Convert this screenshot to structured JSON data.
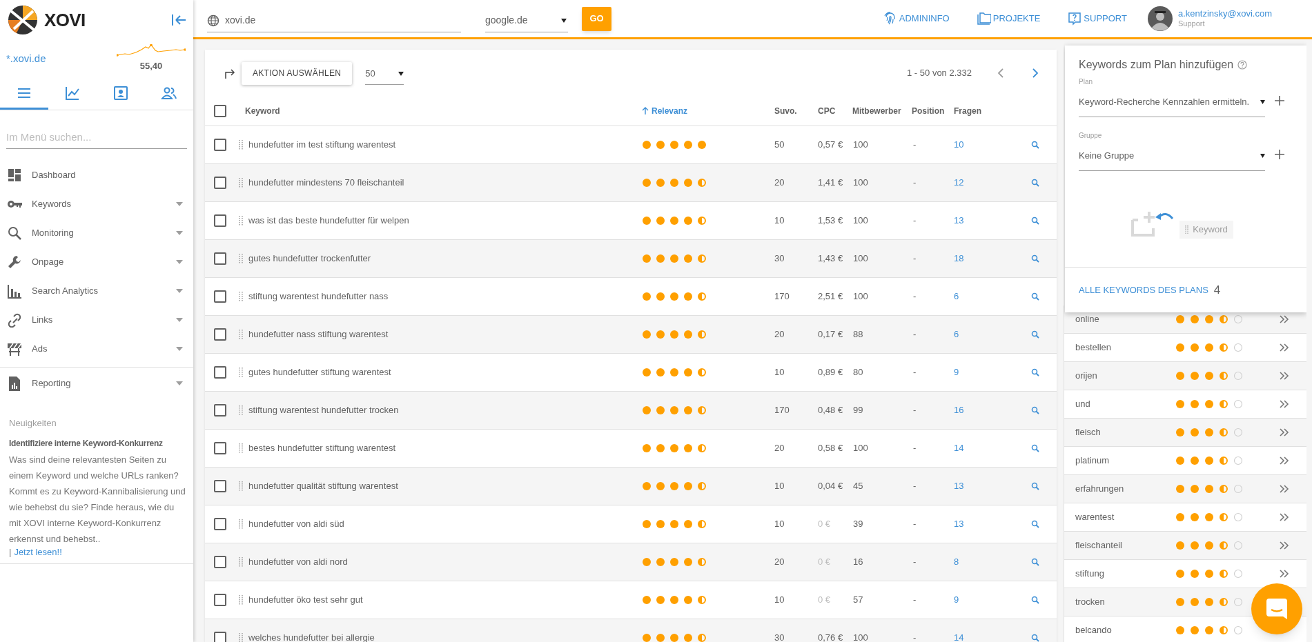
{
  "sidebar": {
    "brand": "XOVI",
    "domain": "*.xovi.de",
    "score": "55,40",
    "tabs": [
      {
        "selected": true
      },
      {
        "selected": false
      },
      {
        "selected": false
      },
      {
        "selected": false
      }
    ],
    "search": {
      "placeholder": "Im Menü suchen..."
    },
    "menu_sections": [
      {
        "items": [
          {
            "label": "Dashboard",
            "expandable": false
          },
          {
            "label": "Keywords",
            "expandable": true
          },
          {
            "label": "Monitoring",
            "expandable": true
          },
          {
            "label": "Onpage",
            "expandable": true
          },
          {
            "label": "Search Analytics",
            "expandable": true
          },
          {
            "label": "Links",
            "expandable": true
          },
          {
            "label": "Ads",
            "expandable": true
          }
        ]
      },
      {
        "items": [
          {
            "label": "Reporting",
            "expandable": true
          }
        ]
      }
    ],
    "news": {
      "heading": "Neuigkeiten",
      "title": "Identifiziere interne Keyword-Konkurrenz",
      "text": "Was sind deine relevantesten Seiten zu einem Keyword und welche URLs ranken? Kommt es zu Keyword-Kannibalisierung und wie behebst du sie? Finde heraus, wie du mit XOVI interne Keyword-Konkurrenz erkennst und behebst..",
      "separator": "|",
      "link": "Jetzt lesen!!"
    }
  },
  "topbar": {
    "domain": "xovi.de",
    "engine": "google.de",
    "go": "GO",
    "links": [
      "ADMININFO",
      "PROJEKTE",
      "SUPPORT"
    ],
    "user": {
      "email": "a.kentzinsky@xovi.com",
      "role": "Support"
    }
  },
  "toolbar": {
    "action": "AKTION AUSWÄHLEN",
    "page_size": "50",
    "range": "1 - 50 von 2.332"
  },
  "table": {
    "select_all_checked": false,
    "columns": [
      "Keyword",
      "Relevanz",
      "Suvo.",
      "CPC",
      "Mitbewerber",
      "Position",
      "Fragen"
    ],
    "rows": [
      {
        "keyword": "hundefutter im test stiftung warentest",
        "checked": false,
        "stars": 5,
        "suvo": "50",
        "cpc": "0,57 €",
        "cpc_muted": false,
        "competitors": "100",
        "position": "-",
        "questions": "10"
      },
      {
        "keyword": "hundefutter mindestens 70 fleischanteil",
        "checked": false,
        "stars": 4.5,
        "suvo": "20",
        "cpc": "1,41 €",
        "cpc_muted": false,
        "competitors": "100",
        "position": "-",
        "questions": "12"
      },
      {
        "keyword": "was ist das beste hundefutter für welpen",
        "checked": false,
        "stars": 4.5,
        "suvo": "10",
        "cpc": "1,53 €",
        "cpc_muted": false,
        "competitors": "100",
        "position": "-",
        "questions": "13"
      },
      {
        "keyword": "gutes hundefutter trockenfutter",
        "checked": false,
        "stars": 4.5,
        "suvo": "30",
        "cpc": "1,43 €",
        "cpc_muted": false,
        "competitors": "100",
        "position": "-",
        "questions": "18"
      },
      {
        "keyword": "stiftung warentest hundefutter nass",
        "checked": false,
        "stars": 4.5,
        "suvo": "170",
        "cpc": "2,51 €",
        "cpc_muted": false,
        "competitors": "100",
        "position": "-",
        "questions": "6"
      },
      {
        "keyword": "hundefutter nass stiftung warentest",
        "checked": false,
        "stars": 4.5,
        "suvo": "20",
        "cpc": "0,17 €",
        "cpc_muted": false,
        "competitors": "88",
        "position": "-",
        "questions": "6"
      },
      {
        "keyword": "gutes hundefutter stiftung warentest",
        "checked": false,
        "stars": 4.5,
        "suvo": "10",
        "cpc": "0,89 €",
        "cpc_muted": false,
        "competitors": "80",
        "position": "-",
        "questions": "9"
      },
      {
        "keyword": "stiftung warentest hundefutter trocken",
        "checked": false,
        "stars": 4.5,
        "suvo": "170",
        "cpc": "0,48 €",
        "cpc_muted": false,
        "competitors": "99",
        "position": "-",
        "questions": "16"
      },
      {
        "keyword": "bestes hundefutter stiftung warentest",
        "checked": false,
        "stars": 4.5,
        "suvo": "20",
        "cpc": "0,58 €",
        "cpc_muted": false,
        "competitors": "100",
        "position": "-",
        "questions": "14"
      },
      {
        "keyword": "hundefutter qualität stiftung warentest",
        "checked": false,
        "stars": 4.5,
        "suvo": "10",
        "cpc": "0,04 €",
        "cpc_muted": false,
        "competitors": "45",
        "position": "-",
        "questions": "13"
      },
      {
        "keyword": "hundefutter von aldi süd",
        "checked": false,
        "stars": 4.5,
        "suvo": "10",
        "cpc": "0 €",
        "cpc_muted": true,
        "competitors": "39",
        "position": "-",
        "questions": "13"
      },
      {
        "keyword": "hundefutter von aldi nord",
        "checked": false,
        "stars": 4.5,
        "suvo": "20",
        "cpc": "0 €",
        "cpc_muted": true,
        "competitors": "16",
        "position": "-",
        "questions": "8"
      },
      {
        "keyword": "hundefutter öko test sehr gut",
        "checked": false,
        "stars": 4.5,
        "suvo": "10",
        "cpc": "0 €",
        "cpc_muted": true,
        "competitors": "57",
        "position": "-",
        "questions": "9"
      },
      {
        "keyword": "welches hundefutter bei allergie",
        "checked": false,
        "stars": 4.5,
        "suvo": "30",
        "cpc": "0,76 €",
        "cpc_muted": false,
        "competitors": "100",
        "position": "-",
        "questions": "14"
      }
    ]
  },
  "plan_card": {
    "title": "Keywords zum Plan hinzufügen",
    "plan_label": "Plan",
    "plan_value": "Keyword-Recherche Kennzahlen ermitteln.",
    "group_label": "Gruppe",
    "group_value": "Keine Gruppe",
    "drop_hint": "Keyword",
    "all_link": "ALLE KEYWORDS DES PLANS",
    "count": "4"
  },
  "word_list": [
    {
      "word": "online",
      "stars": 3.5,
      "arrows": true
    },
    {
      "word": "bestellen",
      "stars": 3.5,
      "arrows": true
    },
    {
      "word": "orijen",
      "stars": 3.5,
      "arrows": true
    },
    {
      "word": "und",
      "stars": 3.5,
      "arrows": true
    },
    {
      "word": "fleisch",
      "stars": 3.5,
      "arrows": true
    },
    {
      "word": "platinum",
      "stars": 3.5,
      "arrows": true
    },
    {
      "word": "erfahrungen",
      "stars": 3.5,
      "arrows": true
    },
    {
      "word": "warentest",
      "stars": 3.5,
      "arrows": true
    },
    {
      "word": "fleischanteil",
      "stars": 3.5,
      "arrows": true
    },
    {
      "word": "stiftung",
      "stars": 3.5,
      "arrows": true
    },
    {
      "word": "trocken",
      "stars": 3.5
    },
    {
      "word": "belcando",
      "stars": 3.5
    }
  ]
}
